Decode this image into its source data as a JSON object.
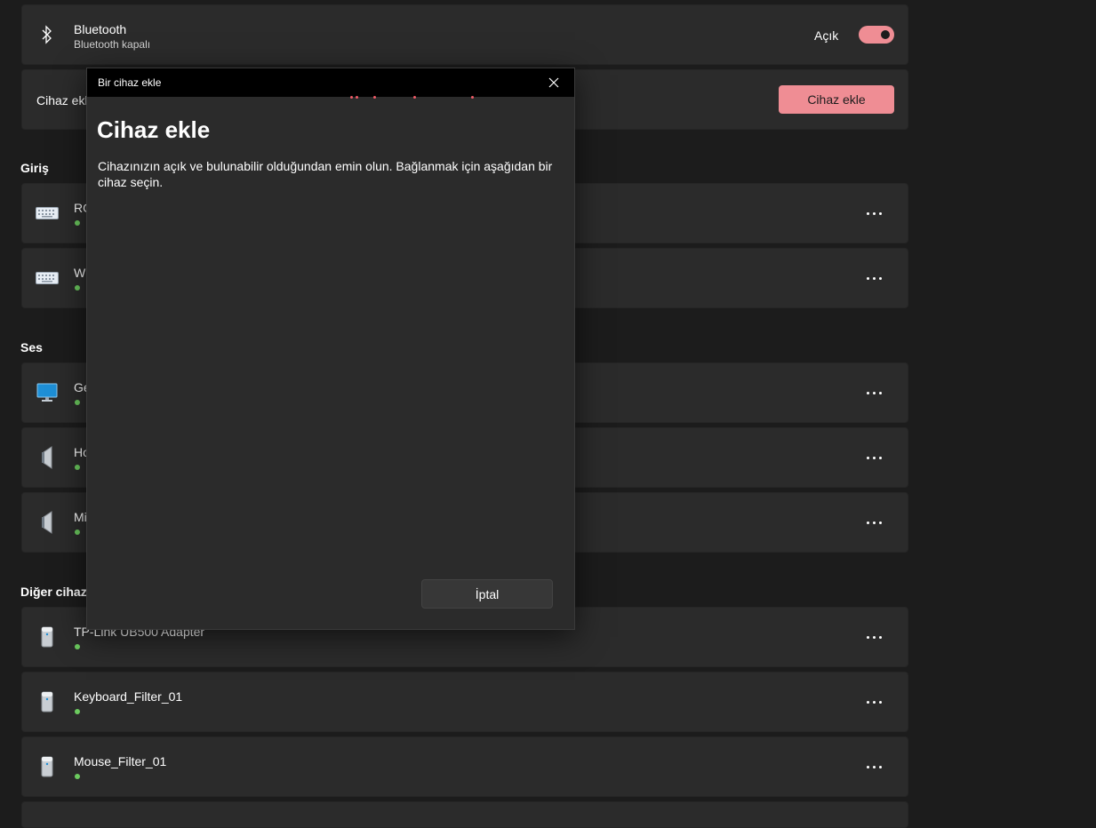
{
  "bluetooth": {
    "title": "Bluetooth",
    "subtitle": "Bluetooth kapalı",
    "toggle_label": "Açık",
    "toggle_on": true,
    "icon": "bluetooth-icon"
  },
  "add_device_row": {
    "label": "Cihaz ekle",
    "button_label": "Cihaz ekle"
  },
  "sections": {
    "input": "Giriş",
    "audio": "Ses",
    "other": "Diğer cihazlar"
  },
  "input_devices": [
    {
      "name": "RO",
      "icon": "keyboard-icon",
      "status": "connected"
    },
    {
      "name": "Wi",
      "icon": "keyboard-icon",
      "status": "connected"
    }
  ],
  "audio_devices": [
    {
      "name": "Ge",
      "icon": "monitor-icon",
      "status": "connected"
    },
    {
      "name": "Ho",
      "icon": "speaker-icon",
      "status": "connected"
    },
    {
      "name": "Mi",
      "icon": "speaker-icon",
      "status": "connected"
    }
  ],
  "other_devices": [
    {
      "name": "TP-Link UB500 Adapter",
      "icon": "device-tower-icon",
      "status": "connected"
    },
    {
      "name": "Keyboard_Filter_01",
      "icon": "device-tower-icon",
      "status": "connected"
    },
    {
      "name": "Mouse_Filter_01",
      "icon": "device-tower-icon",
      "status": "connected"
    }
  ],
  "dialog": {
    "window_title": "Bir cihaz ekle",
    "heading": "Cihaz ekle",
    "description": "Cihazınızın açık ve bulunabilir olduğundan emin olun. Bağlanmak için aşağıdan bir cihaz seçin.",
    "cancel_label": "İptal"
  },
  "colors": {
    "accent": "#ef8d94",
    "status_ok": "#6ccb5f",
    "background": "#1c1c1c",
    "card": "#2b2b2b"
  }
}
